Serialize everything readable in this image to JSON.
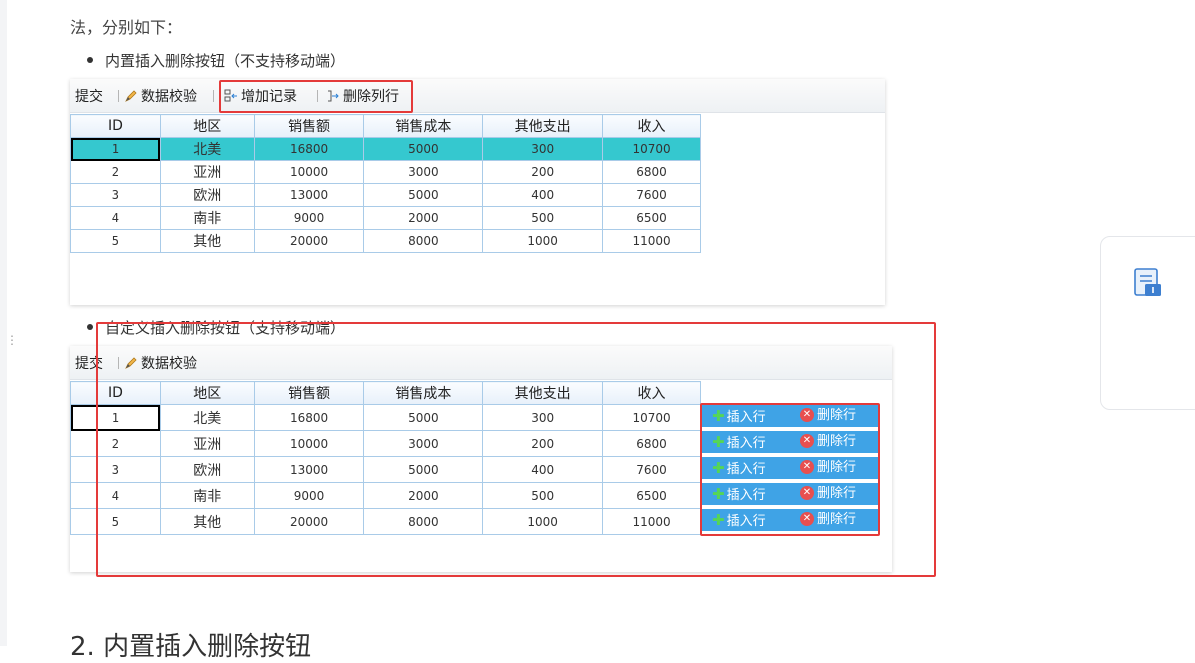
{
  "intro": {
    "line1": "(truncated top line of article text)",
    "line2": "法，分别如下："
  },
  "bullets": {
    "builtin": "内置插入删除按钮（不支持移动端）",
    "custom": "自定义插入删除按钮（支持移动端）"
  },
  "toolbar1": {
    "submit": "提交",
    "validate": "数据校验",
    "add_record": "增加记录",
    "delete_row": "删除列行"
  },
  "toolbar2": {
    "submit": "提交",
    "validate": "数据校验"
  },
  "table": {
    "headers": [
      "ID",
      "地区",
      "销售额",
      "销售成本",
      "其他支出",
      "收入"
    ],
    "rows": [
      [
        "1",
        "北美",
        "16800",
        "5000",
        "300",
        "10700"
      ],
      [
        "2",
        "亚洲",
        "10000",
        "3000",
        "200",
        "6800"
      ],
      [
        "3",
        "欧洲",
        "13000",
        "5000",
        "400",
        "7600"
      ],
      [
        "4",
        "南非",
        "9000",
        "2000",
        "500",
        "6500"
      ],
      [
        "5",
        "其他",
        "20000",
        "8000",
        "1000",
        "11000"
      ]
    ]
  },
  "row_buttons": {
    "insert": "插入行",
    "delete": "删除行"
  },
  "section_heading": "2. 内置插入删除按钮",
  "colors": {
    "selected_row": "#35c8cf",
    "red_highlight": "#e43a3a",
    "button_row_bg": "#3fa3e6",
    "grid_border": "#a9cbe8"
  }
}
